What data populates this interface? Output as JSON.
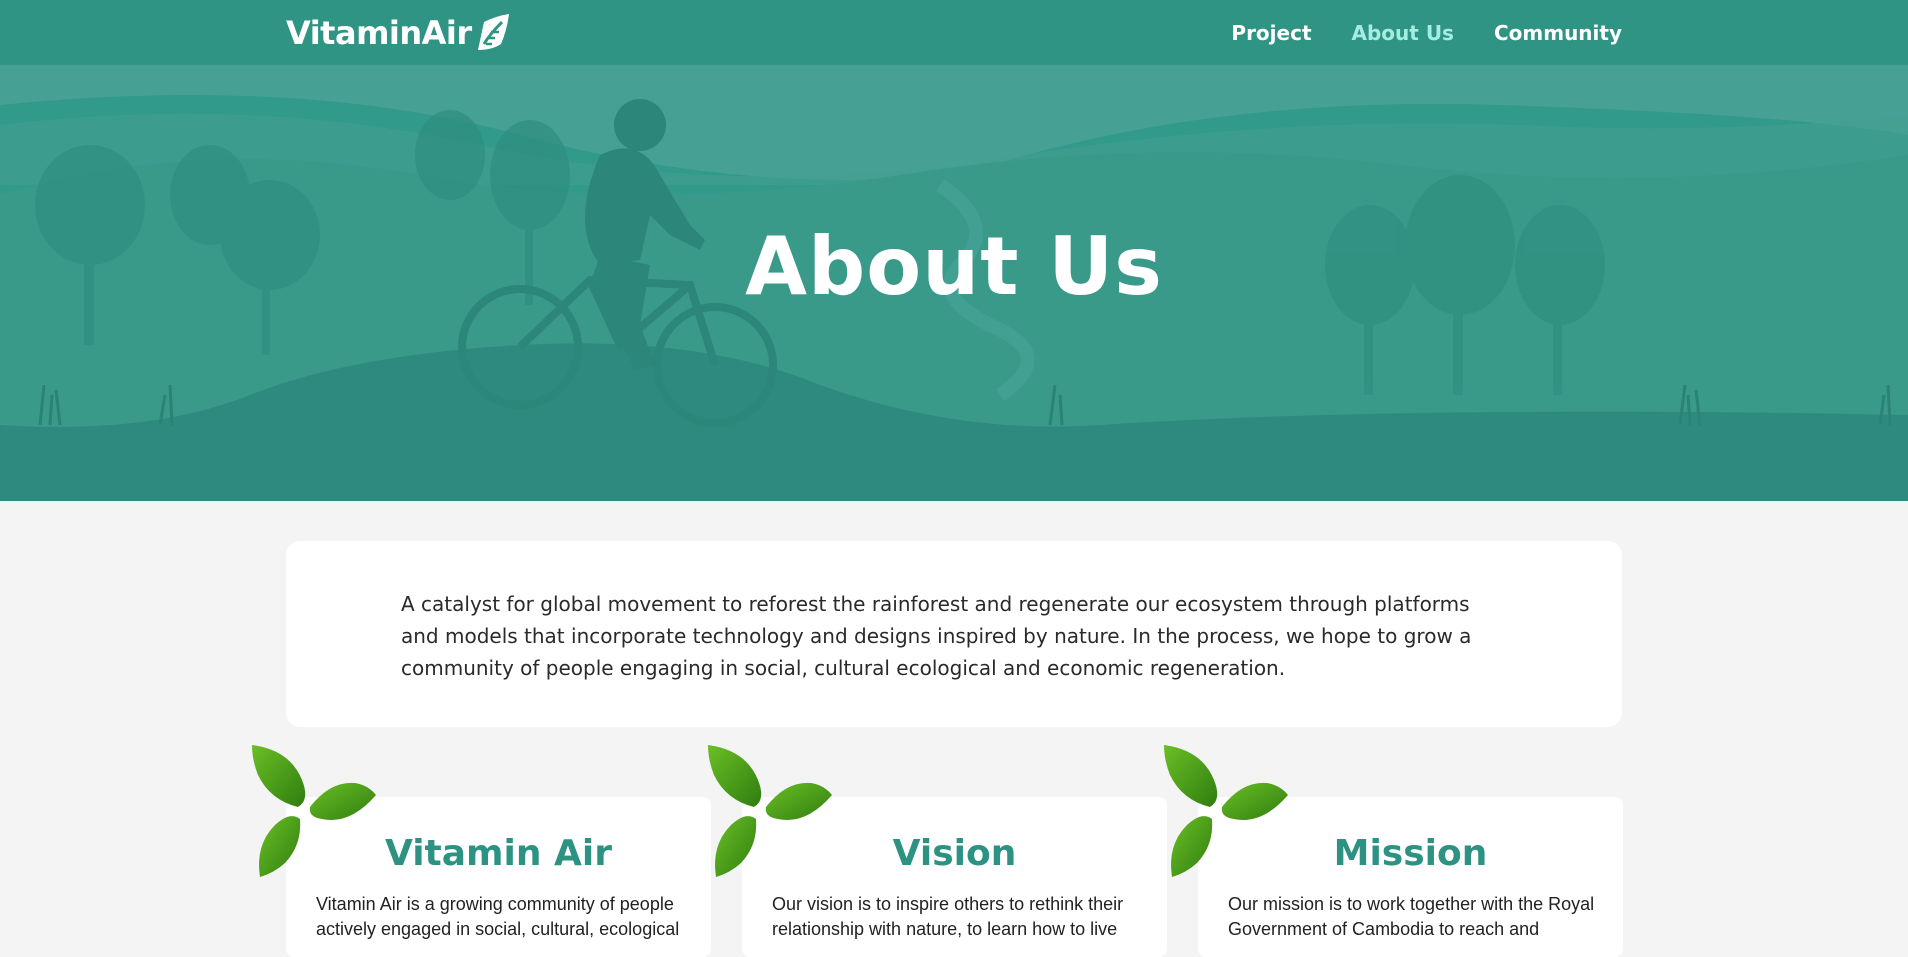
{
  "header": {
    "logo_text": "VitaminAir",
    "nav": [
      "Project",
      "About Us",
      "Community"
    ],
    "active_nav": "About Us"
  },
  "hero": {
    "title": "About Us"
  },
  "intro": {
    "text": "A catalyst for global movement to reforest the rainforest and regenerate our ecosystem through platforms and models that incorporate technology and designs inspired by nature. In the process, we hope to grow a community of people engaging in social, cultural ecological and economic regeneration."
  },
  "cards": [
    {
      "title": "Vitamin Air",
      "text": "Vitamin Air is a growing community of people actively engaged in social, cultural, ecological"
    },
    {
      "title": "Vision",
      "text": "Our vision is to inspire others to rethink their relationship with nature, to learn how to live"
    },
    {
      "title": "Mission",
      "text": "Our mission is to work together with the Royal Government of Cambodia to reach and"
    }
  ],
  "colors": {
    "brand": "#309485",
    "accent_title": "#2e9283",
    "active_nav": "#a6ede1",
    "leaf": "#4e9a1a"
  },
  "icons": {
    "logo_mark": "leaf-logo-icon",
    "card_decoration": "three-leaf-icon"
  }
}
